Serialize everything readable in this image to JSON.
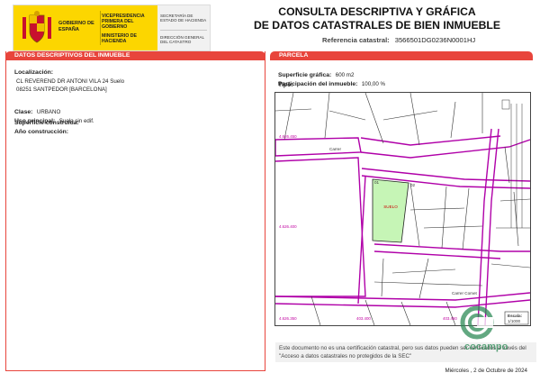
{
  "header": {
    "gov_name": "GOBIERNO DE ESPAÑA",
    "vicepresidencia": "VICEPRESIDENCIA PRIMERA DEL GOBIERNO",
    "ministerio": "MINISTERIO DE HACIENDA",
    "secretaria": "SECRETARÍA DE ESTADO DE HACIENDA",
    "direccion": "DIRECCIÓN GENERAL DEL CATASTRO",
    "title_line1": "CONSULTA DESCRIPTIVA Y GRÁFICA",
    "title_line2": "DE DATOS CATASTRALES DE BIEN INMUEBLE",
    "ref_label": "Referencia catastral:",
    "ref_value": "3566501DG0236N0001HJ"
  },
  "left_panel": {
    "header": "DATOS DESCRIPTIVOS DEL INMUEBLE",
    "localizacion_label": "Localización:",
    "localizacion_line1": "CL REVEREND DR ANTONI VILA 24 Suelo",
    "localizacion_line2": "08251 SANTPEDOR [BARCELONA]",
    "clase_label": "Clase:",
    "clase_value": "URBANO",
    "uso_label": "Uso principal:",
    "uso_value": "Suelo sin edif.",
    "superficie_label": "Superficie construida:",
    "anio_label": "Año construcción:"
  },
  "right_panel": {
    "header": "PARCELA",
    "sup_grafica_label": "Superficie gráfica:",
    "sup_grafica_value": "600 m2",
    "participacion_label": "Participación del inmueble:",
    "participacion_value": "100,00 %",
    "tipo_label": "Tipo:"
  },
  "map": {
    "coord_tl": "4.626.450",
    "coord_ml": "4.626.400",
    "coord_bl": "4.626.350",
    "coord_b1": "403.400",
    "coord_b2": "403.450",
    "parcel_label": "SUELO",
    "plot_01": "01",
    "plot_02": "02",
    "street_1": "Carrer",
    "street_2": "Carrer Comet",
    "scale_label": "Escala:",
    "scale_value": "1/1000"
  },
  "note": {
    "text": "Este documento no es una certificación catastral, pero sus datos pueden ser verificados a través del \"Acceso a datos catastrales no protegidos de la SEC\""
  },
  "date": "Miércoles , 2 de Octubre de 2024",
  "watermark": "cocampo",
  "colors": {
    "accent": "#e8453c",
    "gov_yellow": "#fcd600",
    "parcel_green": "#c6f5b6",
    "boundary_magenta": "#b000a8"
  }
}
